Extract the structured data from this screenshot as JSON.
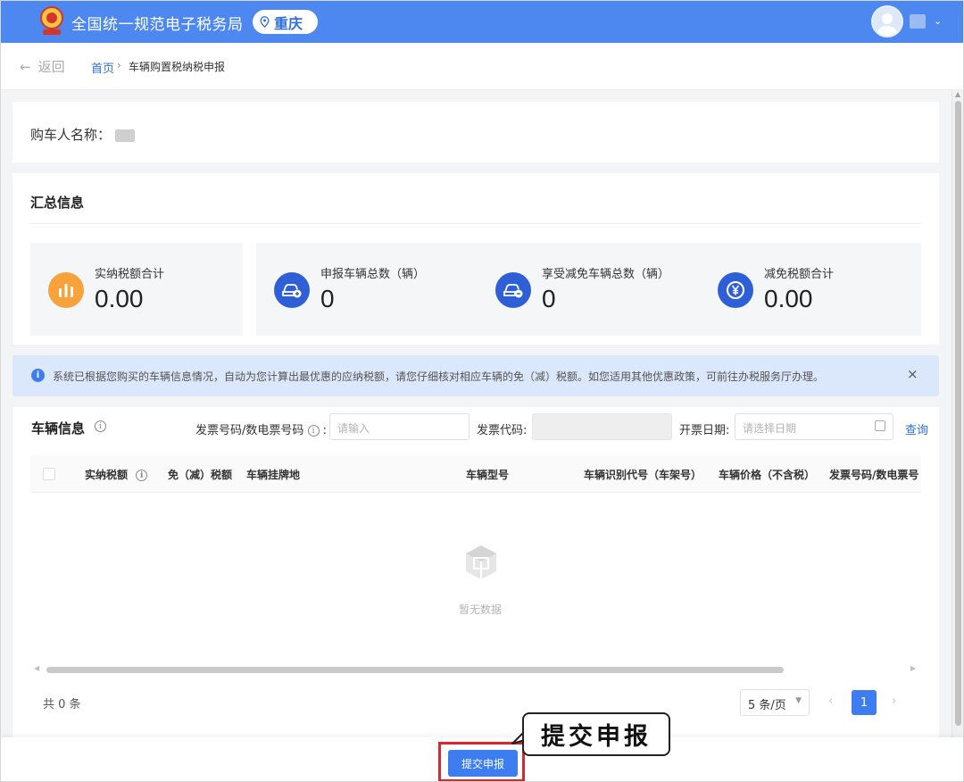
{
  "header": {
    "site_title": "全国统一规范电子税务局",
    "region": "重庆",
    "colors": {
      "brand": "#4c88f0",
      "accent": "#3d7df0"
    }
  },
  "breadcrumb": {
    "back_label": "返回",
    "home": "首页",
    "separator": "›",
    "current": "车辆购置税纳税申报"
  },
  "buyer": {
    "label": "购车人名称："
  },
  "summary": {
    "title": "汇总信息",
    "stats": [
      {
        "label": "实纳税额合计",
        "value": "0.00",
        "icon": "bar-chart-icon",
        "color": "#f7a23b"
      },
      {
        "label": "申报车辆总数（辆）",
        "value": "0",
        "icon": "car-add-icon",
        "color": "#2f5fd6"
      },
      {
        "label": "享受减免车辆总数（辆）",
        "value": "0",
        "icon": "car-minus-icon",
        "color": "#2f5fd6"
      },
      {
        "label": "减免税额合计",
        "value": "0.00",
        "icon": "yuan-refresh-icon",
        "color": "#2f5fd6"
      }
    ]
  },
  "alert": {
    "text": "系统已根据您购买的车辆信息情况，自动为您计算出最优惠的应纳税额，请您仔细核对相应车辆的免（减）税额。如您适用其他优惠政策，可前往办税服务厅办理。",
    "close": "×"
  },
  "vehicles": {
    "title": "车辆信息",
    "filters": {
      "invoice_no_label": "发票号码/数电票号码",
      "invoice_no_placeholder": "请输入",
      "invoice_code_label": "发票代码:",
      "invoice_date_label": "开票日期:",
      "invoice_date_placeholder": "请选择日期",
      "query": "查询"
    },
    "columns": [
      "实纳税额",
      "免（减）税额",
      "车辆挂牌地",
      "车辆型号",
      "车辆识别代号（车架号）",
      "车辆价格（不含税）",
      "发票号码/数电票号"
    ],
    "empty_text": "暂无数据",
    "total": "共 0 条",
    "page_size": "5 条/页",
    "current_page": "1"
  },
  "footer": {
    "submit": "提交申报"
  },
  "annotation": {
    "callout": "提交申报"
  }
}
